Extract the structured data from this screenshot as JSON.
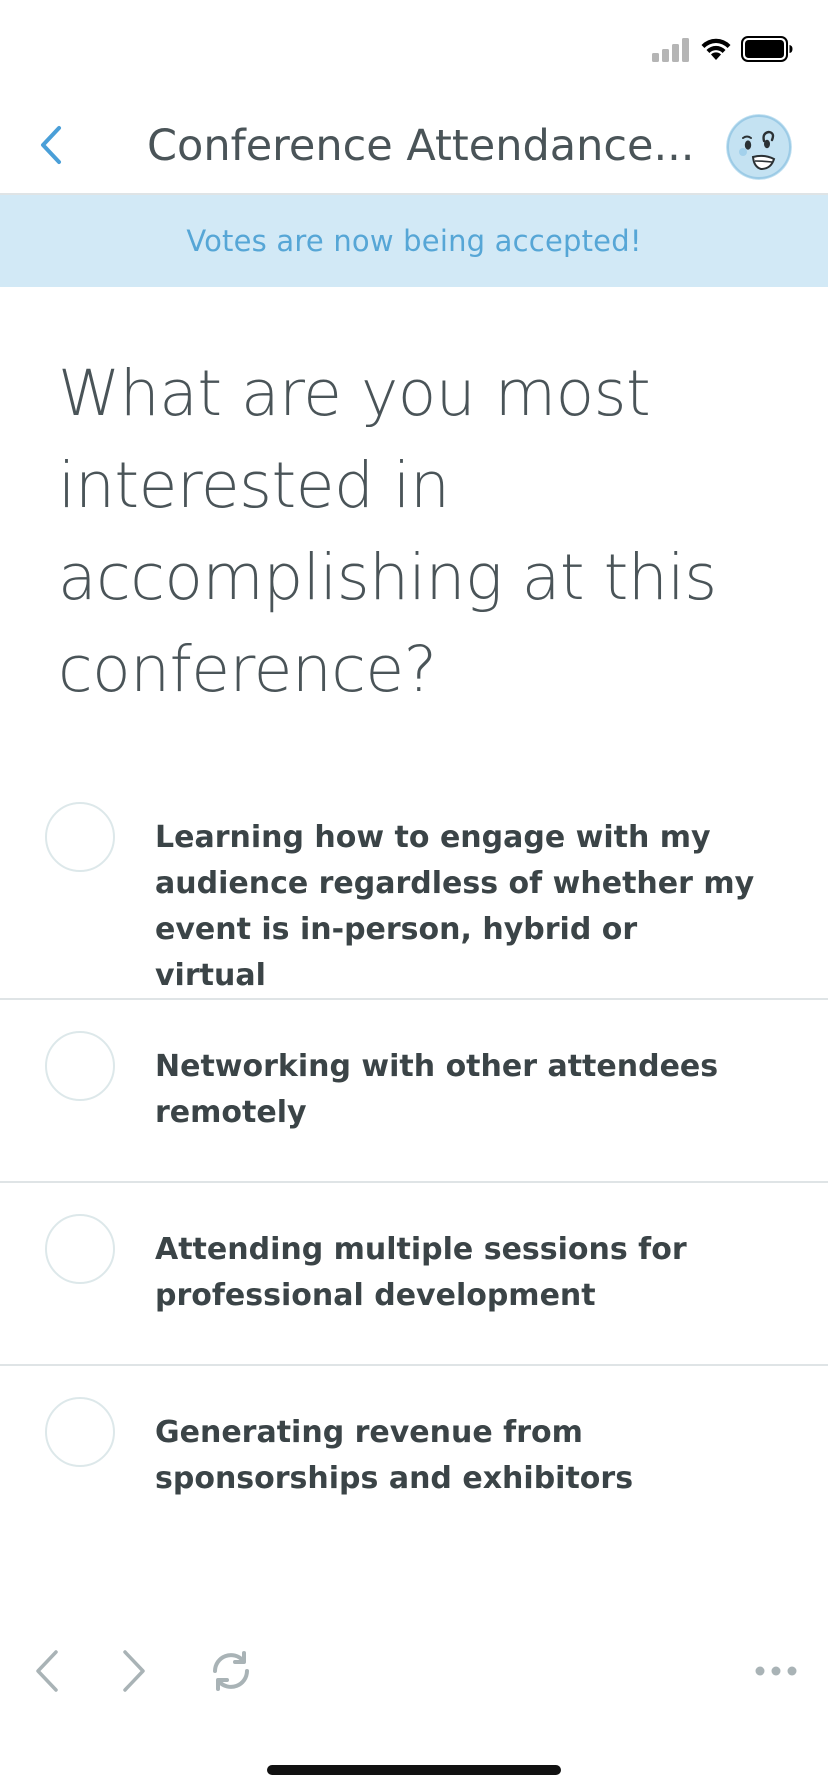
{
  "status_bar": {
    "signal_icon": "cellular-signal-icon",
    "wifi_icon": "wifi-icon",
    "battery_icon": "battery-icon"
  },
  "header": {
    "back_icon": "chevron-left-icon",
    "title": "Conference Attendance...",
    "avatar_icon": "avatar-illustration"
  },
  "banner": {
    "text": "Votes are now being accepted!"
  },
  "poll": {
    "question": "What are you most interested in accomplishing at this conference?",
    "options": [
      {
        "label": "Learning how to engage with my audience regardless of whether my event is in-person, hybrid or virtual",
        "selected": false
      },
      {
        "label": "Networking with other attendees remotely",
        "selected": false
      },
      {
        "label": "Attending multiple sessions for professional development",
        "selected": false
      },
      {
        "label": "Generating revenue from sponsorships and exhibitors",
        "selected": false
      }
    ]
  },
  "toolbar": {
    "back_icon": "chevron-left-icon",
    "forward_icon": "chevron-right-icon",
    "reload_icon": "refresh-icon",
    "more_icon": "more-dots-icon"
  },
  "colors": {
    "accent": "#4a9fd8",
    "banner_background": "#d2e9f6",
    "banner_text": "#56a6d6",
    "text_primary": "#4a5458",
    "divider": "#dfe4e6",
    "toolbar_icon": "#a9b3b6"
  }
}
